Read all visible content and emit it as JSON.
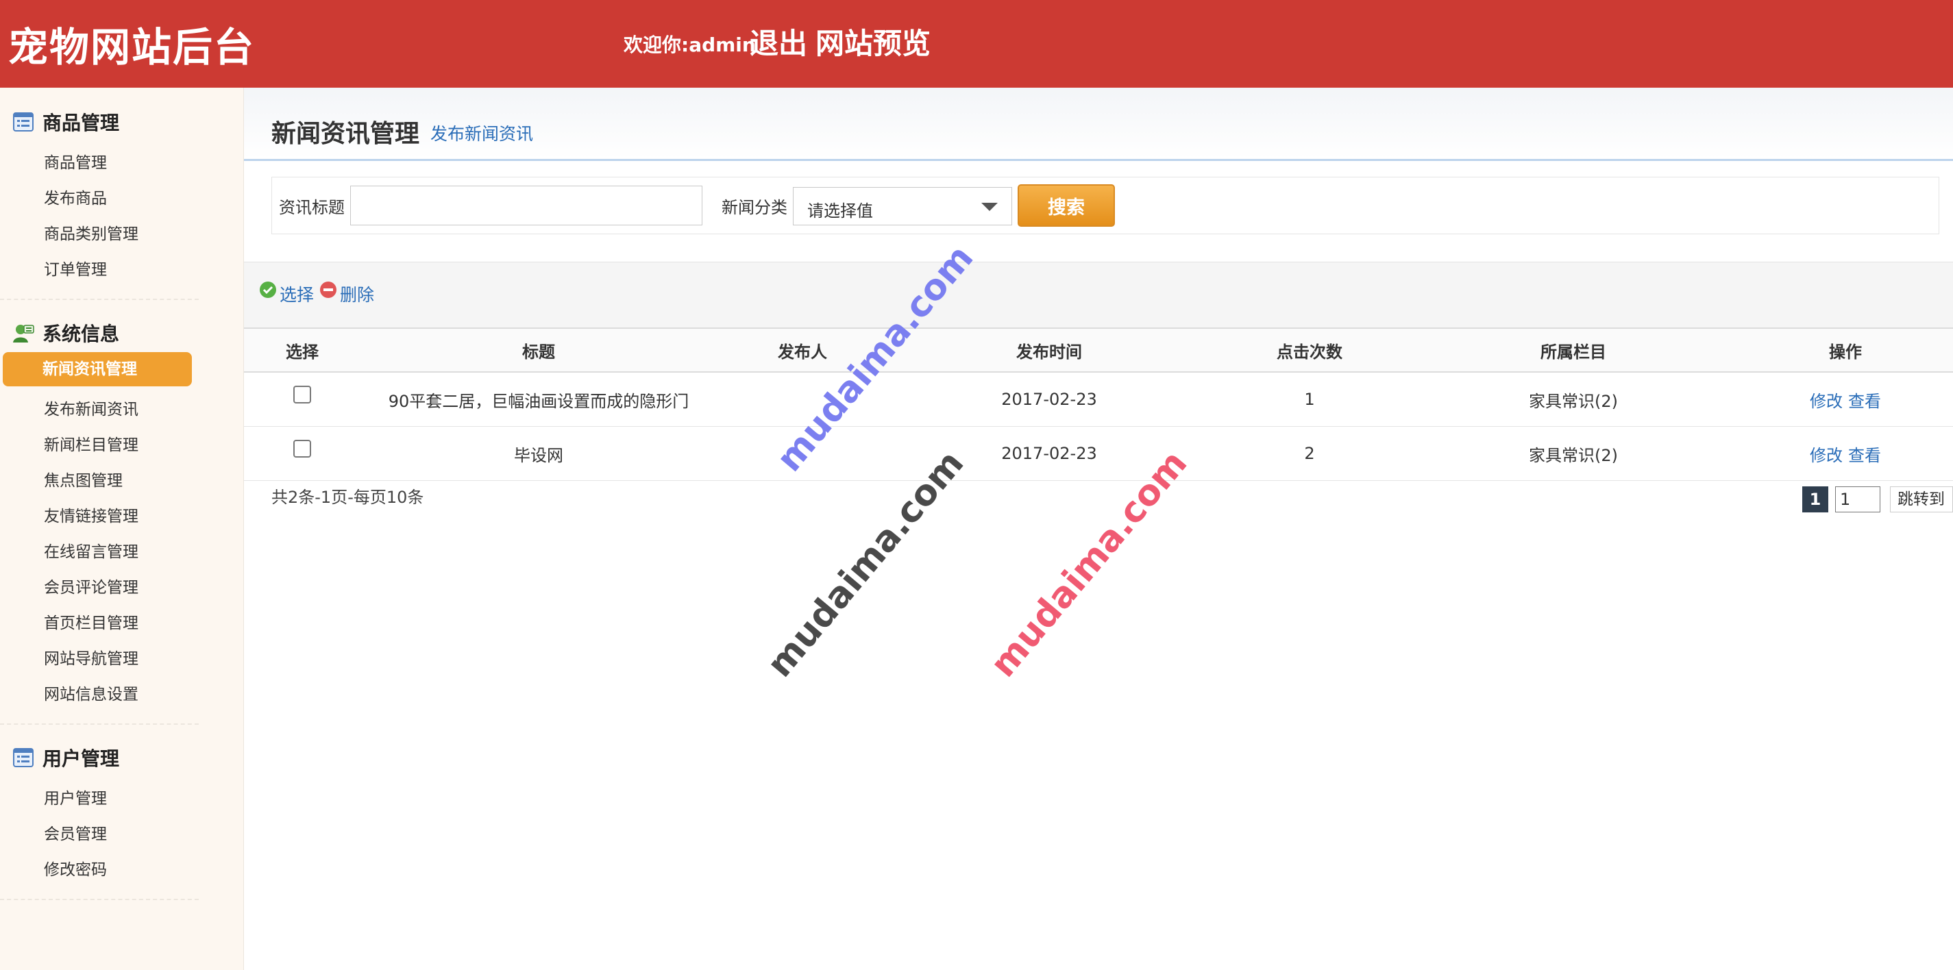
{
  "header": {
    "brand": "宠物网站后台",
    "welcome": "欢迎你:admin",
    "logout": "退出",
    "preview": "网站预览"
  },
  "sidebar": {
    "groups": [
      {
        "title": "商品管理",
        "icon": "list-icon",
        "items": [
          "商品管理",
          "发布商品",
          "商品类别管理",
          "订单管理"
        ]
      },
      {
        "title": "系统信息",
        "icon": "user-settings-icon",
        "items": [
          "新闻资讯管理",
          "发布新闻资讯",
          "新闻栏目管理",
          "焦点图管理",
          "友情链接管理",
          "在线留言管理",
          "会员评论管理",
          "首页栏目管理",
          "网站导航管理",
          "网站信息设置"
        ],
        "active": "新闻资讯管理"
      },
      {
        "title": "用户管理",
        "icon": "list-icon",
        "items": [
          "用户管理",
          "会员管理",
          "修改密码"
        ]
      }
    ]
  },
  "page": {
    "title": "新闻资讯管理",
    "sub_link": "发布新闻资讯"
  },
  "search": {
    "title_label": "资讯标题",
    "title_value": "",
    "category_label": "新闻分类",
    "category_selected": "请选择值",
    "button": "搜索"
  },
  "toolbar": {
    "select": "选择",
    "delete": "删除"
  },
  "table": {
    "headers": [
      "选择",
      "标题",
      "发布人",
      "发布时间",
      "点击次数",
      "所属栏目",
      "操作"
    ],
    "rows": [
      {
        "title": "90平套二居，巨幅油画设置而成的隐形门",
        "publisher": "",
        "date": "2017-02-23",
        "clicks": "1",
        "column": "家具常识(2)",
        "edit": "修改",
        "view": "查看"
      },
      {
        "title": "毕设网",
        "publisher": "",
        "date": "2017-02-23",
        "clicks": "2",
        "column": "家具常识(2)",
        "edit": "修改",
        "view": "查看"
      }
    ]
  },
  "pager": {
    "info": "共2条-1页-每页10条",
    "current": "1",
    "input": "1",
    "go": "跳转到"
  },
  "watermarks": [
    "mudaima.com",
    "mudaima.com",
    "mudaima.com"
  ],
  "colors": {
    "header_bg": "#cc3a33",
    "active_item": "#f0a030",
    "link": "#2a6db8",
    "search_button": "#e8961f"
  }
}
